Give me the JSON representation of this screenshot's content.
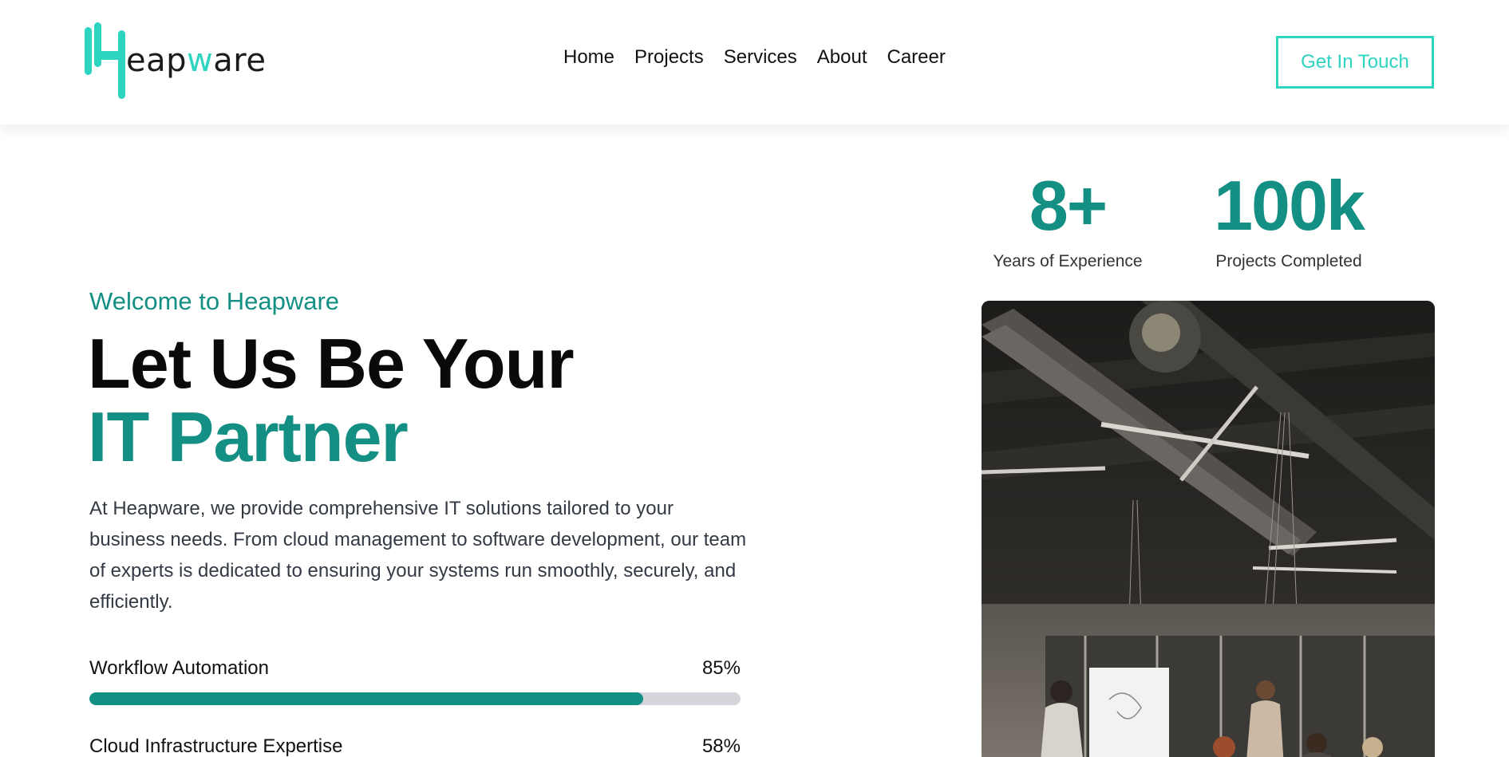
{
  "brand": {
    "logo_text_pre": "eap",
    "logo_text_accent": "w",
    "logo_text_post": "are",
    "accent_color": "#2dd4bf",
    "primary_color": "#138f83"
  },
  "nav": {
    "items": [
      "Home",
      "Projects",
      "Services",
      "About",
      "Career"
    ]
  },
  "header": {
    "cta_label": "Get In Touch"
  },
  "stats": [
    {
      "value": "8+",
      "label": "Years of Experience"
    },
    {
      "value": "100k",
      "label": "Projects Completed"
    }
  ],
  "hero": {
    "welcome": "Welcome to Heapware",
    "headline_line1": "Let Us Be Your",
    "headline_line2": "IT Partner",
    "description": "At Heapware, we provide comprehensive IT solutions tailored to your business needs. From cloud management to software development, our team of experts is dedicated to ensuring your systems run smoothly, securely, and efficiently."
  },
  "skills": [
    {
      "label": "Workflow Automation",
      "percent_text": "85%",
      "percent": 85
    },
    {
      "label": "Cloud Infrastructure Expertise",
      "percent_text": "58%",
      "percent": 58
    }
  ]
}
